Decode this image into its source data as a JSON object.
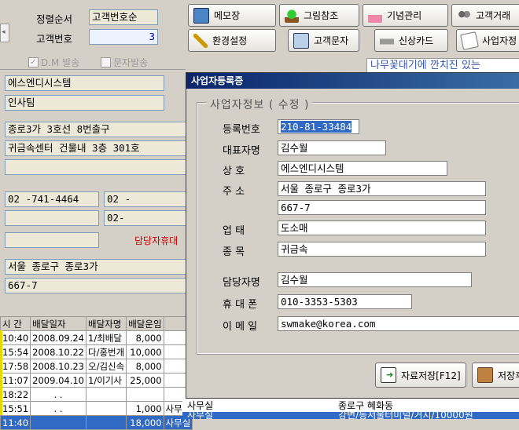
{
  "top": {
    "sort_label": "정렬순서",
    "sort_value": "고객번호순",
    "custno_label": "고객번호",
    "custno_value": "3"
  },
  "toolbar": {
    "memo": "메모장",
    "picture": "그림참조",
    "anniv": "기념관리",
    "customer_trade": "고객거래",
    "settings": "환경설정",
    "sms": "고객문자",
    "card": "신상카드",
    "business": "사업자정"
  },
  "checks": {
    "dm": "D.M 발송",
    "sms_send": "문자발송"
  },
  "left": {
    "company": "에스엔디시스템",
    "dept": "인사팀",
    "addr1": "종로3가 3호선 8번출구",
    "addr2": "귀금속센터 건물내 3층 301호",
    "addr3": "",
    "phone1": "02  -741-4464",
    "phone2": "02  -",
    "fax": "",
    "fax2": "02-",
    "mobile": "",
    "mobile_label": "담당자휴대",
    "dong": "서울 종로구 종로3가",
    "bunji": "667-7"
  },
  "banner": "나무꽃대기에 깐치진 있는",
  "grid": {
    "headers": [
      "시 간",
      "배달일자",
      "배달자명",
      "배달운임",
      ""
    ],
    "rows": [
      [
        "10:40",
        "2008.09.24",
        "1/최배달",
        "8,000",
        ""
      ],
      [
        "15:54",
        "2008.10.22",
        "다/홍번개",
        "10,000",
        ""
      ],
      [
        "17:58",
        "2008.10.23",
        "오/김신속",
        "8,000",
        ""
      ],
      [
        "11:07",
        "2009.04.10",
        "1/이기사",
        "25,000",
        ""
      ],
      [
        "18:22",
        ". .",
        "",
        "",
        ""
      ],
      [
        "15:51",
        ". .",
        "",
        "1,000",
        "사무실"
      ]
    ],
    "extra_row": {
      "col6": "종로구 혜화동"
    },
    "selected_row": [
      "11:40",
      "",
      "",
      "18,000",
      "사무실",
      "강변/동서울터미널/거지/10000원"
    ]
  },
  "dialog": {
    "title": "사업자등록증",
    "group": "사업자정보 ( 수정 )",
    "reg_no_label": "등록번호",
    "reg_no": "210-81-33484",
    "ceo_label": "대표자명",
    "ceo": "김수월",
    "company_label": "상    호",
    "company": "에스엔디시스템",
    "addr_label": "주    소",
    "addr1": "서울 종로구 종로3가",
    "addr2": "667-7",
    "biz_type_label": "업    태",
    "biz_type": "도소매",
    "biz_item_label": "종    목",
    "biz_item": "귀금속",
    "manager_label": "담당자명",
    "manager": "김수월",
    "mobile_label": "휴 대 폰",
    "mobile": "010-3353-5303",
    "email_label": "이 메 일",
    "email": "swmake@korea.com",
    "save_btn": "자료저장[F12]",
    "save_exit_btn": "저장후"
  },
  "colors": {
    "title_start": "#0a246a",
    "title_end": "#3a6ea5",
    "accent_text": "#cc0000",
    "select": "#316ac5"
  }
}
